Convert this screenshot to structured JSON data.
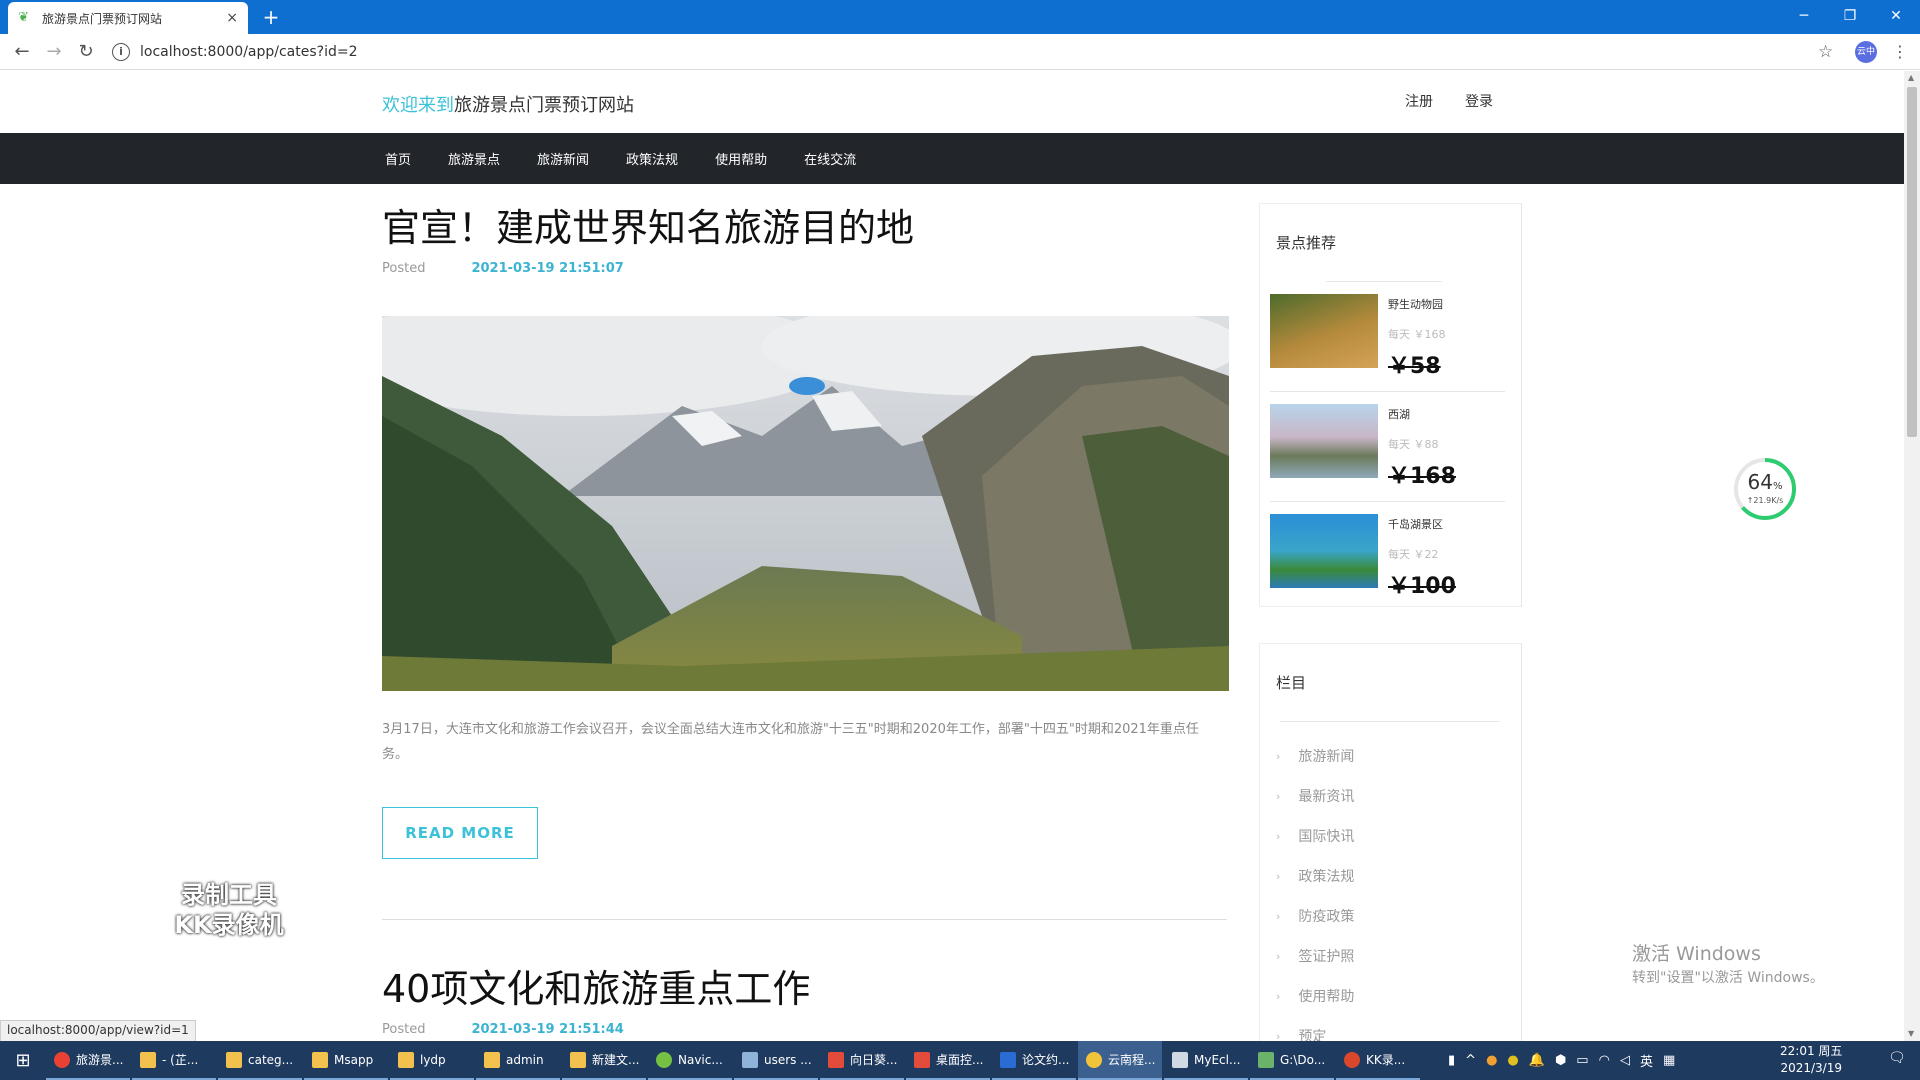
{
  "browser": {
    "tab_title": "旅游景点门票预订网站",
    "tab_close": "×",
    "new_tab": "+",
    "url": "localhost:8000/app/cates?id=2",
    "profile_label": "云中"
  },
  "header": {
    "welcome": "欢迎来到",
    "site_name": "旅游景点门票预订网站",
    "register": "注册",
    "login": "登录"
  },
  "nav": {
    "items": [
      "首页",
      "旅游景点",
      "旅游新闻",
      "政策法规",
      "使用帮助",
      "在线交流"
    ]
  },
  "articles": [
    {
      "title": "官宣！建成世界知名旅游目的地",
      "posted_label": "Posted",
      "date": "2021-03-19 21:51:07",
      "summary": "3月17日，大连市文化和旅游工作会议召开，会议全面总结大连市文化和旅游\"十三五\"时期和2020年工作，部署\"十四五\"时期和2021年重点任务。",
      "read_more": "READ MORE"
    },
    {
      "title": "40项文化和旅游重点工作",
      "posted_label": "Posted",
      "date": "2021-03-19 21:51:44"
    }
  ],
  "sidebar": {
    "recommend_title": "景点推荐",
    "spots": [
      {
        "name": "野生动物园",
        "sub": "每天  ￥168",
        "price": "￥58"
      },
      {
        "name": "西湖",
        "sub": "每天  ￥88",
        "price": "￥168"
      },
      {
        "name": "千岛湖景区",
        "sub": "每天  ￥22",
        "price": "￥100"
      }
    ],
    "category_title": "栏目",
    "categories": [
      "旅游新闻",
      "最新资讯",
      "国际快讯",
      "政策法规",
      "防疫政策",
      "签证护照",
      "使用帮助",
      "预定"
    ]
  },
  "overlay": {
    "gauge_percent": "64",
    "gauge_unit": "%",
    "gauge_speed": "↑21.9K/s",
    "watermark_line1": "录制工具",
    "watermark_line2": "KK录像机",
    "activate_title": "激活 Windows",
    "activate_sub": "转到\"设置\"以激活 Windows。",
    "status_url": "localhost:8000/app/view?id=1"
  },
  "taskbar": {
    "items": [
      "旅游景...",
      "- (芷...",
      "categ...",
      "Msapp",
      "lydp",
      "admin",
      "新建文...",
      "Navic...",
      "users ...",
      "向日葵...",
      "桌面控...",
      "论文约...",
      "云南程...",
      "MyEcl...",
      "G:\\Do...",
      "KK录..."
    ],
    "tray_lang": "英",
    "time": "22:01 周五",
    "date": "2021/3/19"
  },
  "colors": {
    "accent": "#3cc2d8",
    "nav_bg": "#22252a",
    "date_color": "#3cb4d1"
  }
}
